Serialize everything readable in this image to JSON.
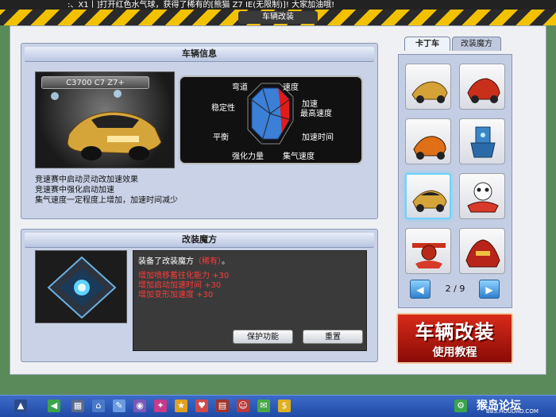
{
  "ticker": {
    "text": ":、X1丨]打开红色水气球，获得了稀有的[熊猫 Z7 IE(无限制)]! 大家加油哦!"
  },
  "window": {
    "title": "车辆改装"
  },
  "car_info": {
    "header": "车辆信息",
    "car_name": "C3700 C7 Z7+",
    "radar_labels": [
      "弯道",
      "速度",
      "加速",
      "最高速度",
      "加速时间",
      "集气速度",
      "强化力量",
      "平衡",
      "稳定性"
    ],
    "description": [
      "竞速赛中启动灵动改加速效果",
      "竞速赛中强化启动加速",
      "集气速度一定程度上增加，加速时间减少"
    ]
  },
  "modify": {
    "header": "改装魔方",
    "equipped_prefix": "装备了改装魔方",
    "equipped_tag": "（稀有）",
    "equipped_suffix": "。",
    "bonuses": [
      "增加喷移蓄往化能力 +30",
      "增加启动加速时间 +30",
      "增加变形加速度 +30"
    ],
    "protect_button": "保护功能",
    "reset_button": "重置"
  },
  "tabs": {
    "kart": "卡丁车",
    "magic": "改装魔方",
    "active": "kart"
  },
  "car_grid": {
    "cars": [
      "gold-sportscar",
      "red-racer",
      "orange-kart",
      "blue-robot",
      "selected-gold-sportscar",
      "panda-kart",
      "red-propeller-kart",
      "red-gold-kart"
    ],
    "selected_index": 4
  },
  "pager": {
    "text": "2 / 9",
    "prev_icon": "left-arrow-icon",
    "next_icon": "right-arrow-icon"
  },
  "promo": {
    "line1": "车辆改装",
    "line2": "使用教程"
  },
  "watermark": {
    "text": "猴岛论坛",
    "sub": "BBS.HOUDAO.COM"
  },
  "colors": {
    "accent": "#d82a1a",
    "bonus": "#ff3c3c",
    "radar_fill": "#3b7fd6",
    "radar_highlight": "#e11a1a"
  }
}
